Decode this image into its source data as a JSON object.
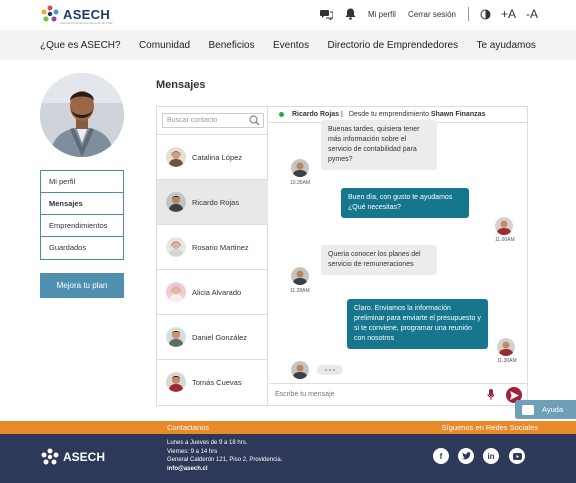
{
  "brand": {
    "name": "ASECH",
    "tagline": "Asociación de Emprendedores de Chile"
  },
  "topbar": {
    "profile_link": "Mi perfil",
    "logout_link": "Cerrar sesión",
    "font_increase": "+A",
    "font_decrease": "-A"
  },
  "nav": {
    "items": [
      "¿Que es ASECH?",
      "Comunidad",
      "Beneficios",
      "Eventos",
      "Directorio de Emprendedores",
      "Te ayudamos"
    ]
  },
  "sidebar": {
    "items": [
      "Mi perfil",
      "Mensajes",
      "Emprendimientos",
      "Guardados"
    ],
    "active": "Mensajes",
    "upgrade_button": "Mejora tu plan"
  },
  "messages": {
    "title": "Mensajes",
    "search_placeholder": "Buscar contacto",
    "contacts": [
      "Catalina López",
      "Ricardo Rojas",
      "Rosario Martinez",
      "Alicia Alvarado",
      "Daniel González",
      "Tomás Cuevas"
    ],
    "active_contact": "Ricardo Rojas",
    "chat_header": {
      "name": "Ricardo Rojas",
      "separator": "|",
      "from_text": "Desde tu emprendimiento",
      "business": "Shawn Finanzas"
    },
    "conversation": [
      {
        "direction": "in",
        "text": "Buenas tardes, quisiera tener más información sobre el servicio de contabilidad para pymes?",
        "time": "10.35AM"
      },
      {
        "direction": "out",
        "text": "Buen día, con gusto te ayudamos ¿Qué necesitas?",
        "time": "11.00AM"
      },
      {
        "direction": "in",
        "text": "Queria conocer los planes del servicio de remuneraciones",
        "time": "11.28AM"
      },
      {
        "direction": "out",
        "text": "Claro. Enviamos la información preliminar para enviarte el presupuesto y si te conviene, programar una reunión con nosotros",
        "time": "11.30AM"
      }
    ],
    "input_placeholder": "Escribe tu mensaje"
  },
  "help_widget": {
    "label": "Ayuda"
  },
  "footer": {
    "contact_heading": "Contactanos",
    "social_heading": "Síguenos en Redes Sociales",
    "hours": [
      "Lunes a Jueves de  9 a 18 hrs.",
      "Viernes: 9 a 14 hrs"
    ],
    "address": "General Calderón 121, Piso 2, Providencia.",
    "email": "info@asech.cl",
    "social": [
      "facebook-icon",
      "twitter-icon",
      "linkedin-icon",
      "youtube-icon"
    ]
  },
  "colors": {
    "navy": "#2e3858",
    "teal": "#16768d",
    "accent_blue": "#4f8fb0",
    "orange": "#e98a2a",
    "send_red": "#a0203a",
    "online_green": "#2ea84a"
  }
}
